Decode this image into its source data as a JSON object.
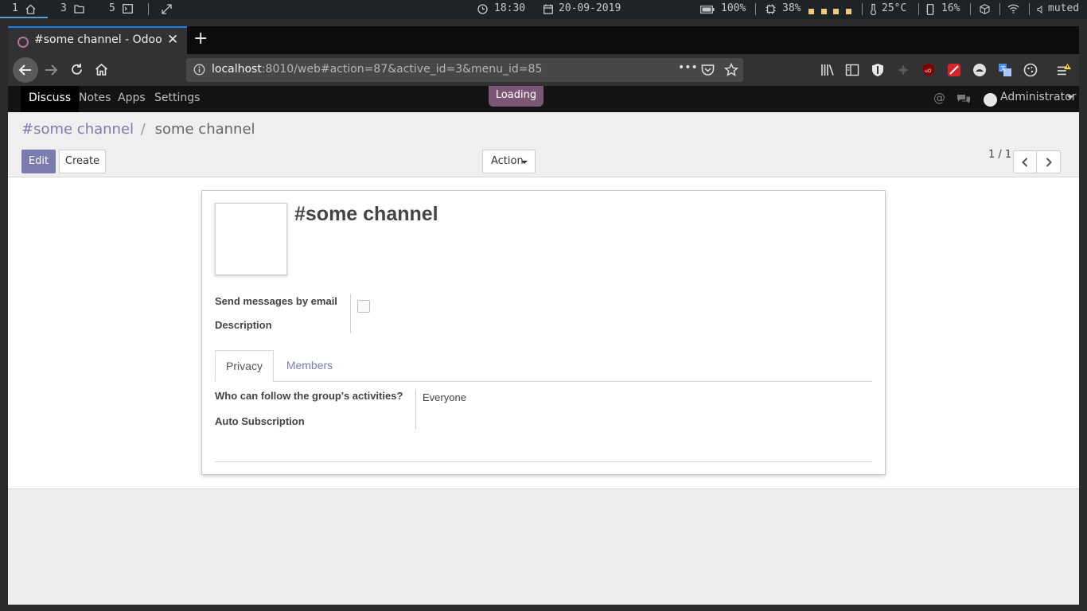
{
  "system_bar": {
    "workspaces": [
      {
        "num": "1",
        "icon": "home-icon"
      },
      {
        "num": "3",
        "icon": "folder-icon"
      },
      {
        "num": "5",
        "icon": "terminal-icon"
      }
    ],
    "time": "18:30",
    "date": "20-09-2019",
    "battery": "100%",
    "cpu": "38%",
    "temperature": "25°C",
    "memory": "16%",
    "volume": "muted"
  },
  "browser": {
    "tab_title": "#some channel - Odoo",
    "url_host": "localhost",
    "url_rest": ":8010/web#action=87&active_id=3&menu_id=85",
    "page_actions": "•••"
  },
  "odoo": {
    "menu": [
      "Discuss",
      "Notes",
      "Apps",
      "Settings"
    ],
    "loading": "Loading",
    "user": "Administrator",
    "breadcrumb": {
      "parent": "#some channel",
      "separator": "/",
      "current": "some channel"
    },
    "buttons": {
      "edit": "Edit",
      "create": "Create",
      "action": "Action"
    },
    "pager": "1 / 1",
    "record": {
      "title": "#some channel",
      "fields": {
        "send_email_label": "Send messages by email",
        "description_label": "Description"
      },
      "tabs": [
        "Privacy",
        "Members"
      ],
      "privacy": {
        "follow_label": "Who can follow the group's activities?",
        "follow_value": "Everyone",
        "auto_sub_label": "Auto Subscription"
      }
    }
  }
}
